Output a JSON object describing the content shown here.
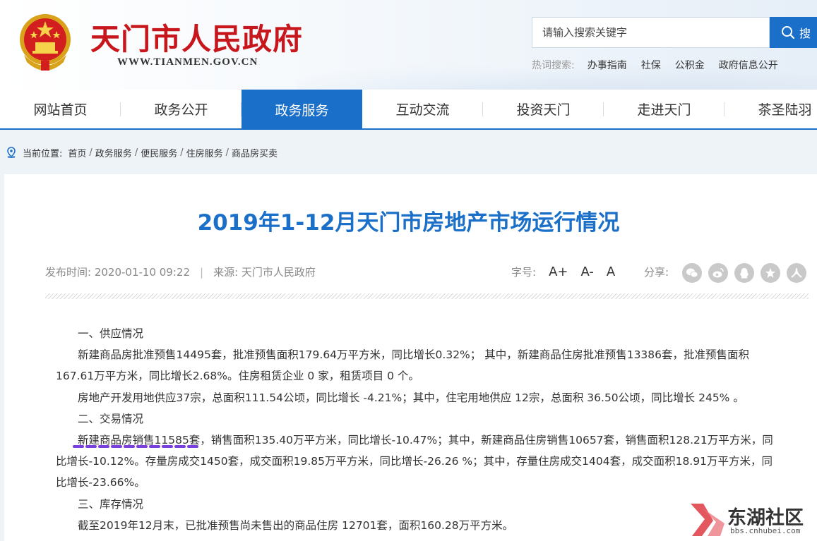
{
  "header": {
    "site_title": "天门市人民政府",
    "site_url": "WWW.TIANMEN.GOV.CN",
    "search_placeholder": "请输入搜索关键字",
    "search_button": "搜",
    "hot_label": "热词搜索:",
    "hot_words": [
      "办事指南",
      "社保",
      "公积金",
      "政府信息公开"
    ]
  },
  "nav": {
    "items": [
      "网站首页",
      "政务公开",
      "政务服务",
      "互动交流",
      "投资天门",
      "走进天门",
      "茶圣陆羽"
    ],
    "active": "政务服务"
  },
  "breadcrumb": {
    "label": "当前位置:",
    "items": [
      "首页",
      "政务服务",
      "便民服务",
      "住房服务",
      "商品房买卖"
    ],
    "separator": "/"
  },
  "article": {
    "title": "2019年1-12月天门市房地产市场运行情况",
    "publish_time": "发布时间: 2020-01-10 09:22",
    "source": "来源: 天门市人民政府",
    "font_size_label": "字号:",
    "font_size_options": [
      "A+",
      "A-",
      "A"
    ],
    "share_label": "分享:",
    "share_icons": [
      "wechat-icon",
      "weibo-icon",
      "qq-icon",
      "star-icon",
      "renren-icon"
    ],
    "paragraphs": [
      "一、供应情况",
      "新建商品房批准预售14495套，批准预售面积179.64万平方米，同比增长0.32%；  其中，新建商品住房批准预售13386套，批准预售面积167.61万平方米，同比增长2.68%。住房租赁企业 0 家，租赁项目 0 个。",
      "房地产开发用地供应37宗，总面积111.54公顷，同比增长 -4.21%；其中，住宅用地供应 12宗，总面积 36.50公顷，同比增长 245% 。",
      "二、交易情况",
      "新建商品房销售11585套，销售面积135.40万平方米，同比增长-10.47%；其中，新建商品住房销售10657套，销售面积128.21万平方米，同比增长-10.12%。存量房成交1450套，成交面积19.85万平方米，同比增长-26.26 %；其中，存量住房成交1404套，成交面积18.91万平方米，同比增长-23.66%。",
      "三、库存情况",
      "截至2019年12月末，已批准预售尚未售出的商品住房  12701套，面积160.28万平方米。"
    ]
  },
  "watermark": {
    "text": "东湖社区",
    "url": "bbs.cnhubei.com"
  },
  "colors": {
    "brand_blue": "#1a6fc9",
    "brand_red": "#c8161d",
    "mark_purple": "#7b3fe0"
  }
}
